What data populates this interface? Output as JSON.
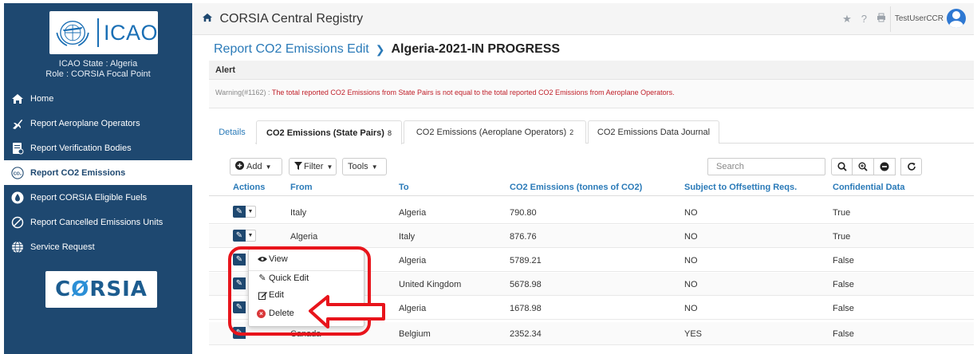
{
  "sidebar": {
    "logo_text": "ICAO",
    "state_line": "ICAO State : Algeria",
    "role_line": "Role : CORSIA Focal Point",
    "items": [
      {
        "label": "Home",
        "icon": "home-icon"
      },
      {
        "label": "Report Aeroplane Operators",
        "icon": "plane-icon"
      },
      {
        "label": "Report Verification Bodies",
        "icon": "document-icon"
      },
      {
        "label": "Report CO2 Emissions",
        "icon": "co2-icon",
        "active": true
      },
      {
        "label": "Report CORSIA Eligible Fuels",
        "icon": "fuel-drop-icon"
      },
      {
        "label": "Report Cancelled Emissions Units",
        "icon": "cancel-circle-icon"
      },
      {
        "label": "Service Request",
        "icon": "globe-icon"
      }
    ],
    "corsia_prefix": "C",
    "corsia_mark": "Ø",
    "corsia_suffix": "RSIA"
  },
  "header": {
    "title": "CORSIA Central Registry",
    "user": "TestUserCCR"
  },
  "breadcrumb": {
    "parent": "Report CO2 Emissions Edit",
    "current": "Algeria-2021-IN PROGRESS"
  },
  "alert": {
    "heading": "Alert",
    "code": "Warning(#1162) :",
    "message": "The total reported CO2 Emissions from State Pairs is not equal to the total reported CO2 Emissions from Aeroplane Operators."
  },
  "tabs": [
    {
      "label": "Details",
      "count": ""
    },
    {
      "label": "CO2 Emissions (State Pairs)",
      "count": "8"
    },
    {
      "label": "CO2 Emissions (Aeroplane Operators)",
      "count": "2"
    },
    {
      "label": "CO2 Emissions Data Journal",
      "count": ""
    }
  ],
  "toolbar": {
    "add": "Add",
    "filter": "Filter",
    "tools": "Tools",
    "search_placeholder": "Search"
  },
  "table": {
    "headers": [
      "Actions",
      "From",
      "To",
      "CO2 Emissions (tonnes of CO2)",
      "Subject to Offsetting Reqs.",
      "Confidential Data"
    ],
    "rows": [
      {
        "from": "Italy",
        "to": "Algeria",
        "co2": "790.80",
        "subject": "NO",
        "confidential": "True"
      },
      {
        "from": "Algeria",
        "to": "Italy",
        "co2": "876.76",
        "subject": "NO",
        "confidential": "True"
      },
      {
        "from": "",
        "to": "Algeria",
        "co2": "5789.21",
        "subject": "NO",
        "confidential": "False"
      },
      {
        "from": "",
        "to": "United Kingdom",
        "co2": "5678.98",
        "subject": "NO",
        "confidential": "False"
      },
      {
        "from": "",
        "to": "Algeria",
        "co2": "1678.98",
        "subject": "NO",
        "confidential": "False"
      },
      {
        "from": "Canada",
        "to": "Belgium",
        "co2": "2352.34",
        "subject": "YES",
        "confidential": "False"
      }
    ]
  },
  "context_menu": {
    "view": "View",
    "quick_edit": "Quick Edit",
    "edit": "Edit",
    "delete": "Delete"
  },
  "colors": {
    "sidebar_bg": "#1e4870",
    "link_blue": "#2a7ab8",
    "alert_red": "#c0202a",
    "highlight_red": "#e8141b"
  }
}
